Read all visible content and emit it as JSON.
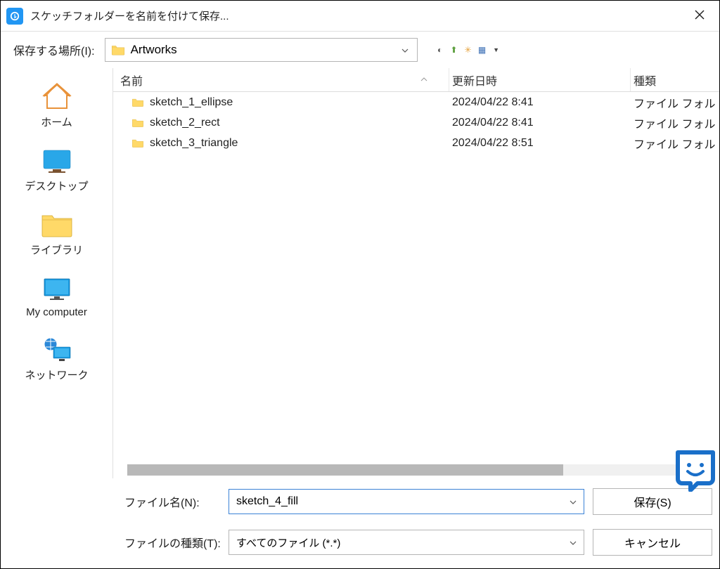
{
  "title": "スケッチフォルダーを名前を付けて保存...",
  "location": {
    "label": "保存する場所(I):",
    "folder": "Artworks"
  },
  "sidebar": [
    {
      "id": "home",
      "label": "ホーム"
    },
    {
      "id": "desktop",
      "label": "デスクトップ"
    },
    {
      "id": "library",
      "label": "ライブラリ"
    },
    {
      "id": "computer",
      "label": "My computer"
    },
    {
      "id": "network",
      "label": "ネットワーク"
    }
  ],
  "columns": {
    "name": "名前",
    "date": "更新日時",
    "type": "種類"
  },
  "files": [
    {
      "name": "sketch_1_ellipse",
      "date": "2024/04/22 8:41",
      "type": "ファイル フォル"
    },
    {
      "name": "sketch_2_rect",
      "date": "2024/04/22 8:41",
      "type": "ファイル フォル"
    },
    {
      "name": "sketch_3_triangle",
      "date": "2024/04/22 8:51",
      "type": "ファイル フォル"
    }
  ],
  "form": {
    "filename_label": "ファイル名(N):",
    "filename_value": "sketch_4_fill",
    "filetype_label": "ファイルの種類(T):",
    "filetype_value": "すべてのファイル (*.*)",
    "save": "保存(S)",
    "cancel": "キャンセル"
  }
}
